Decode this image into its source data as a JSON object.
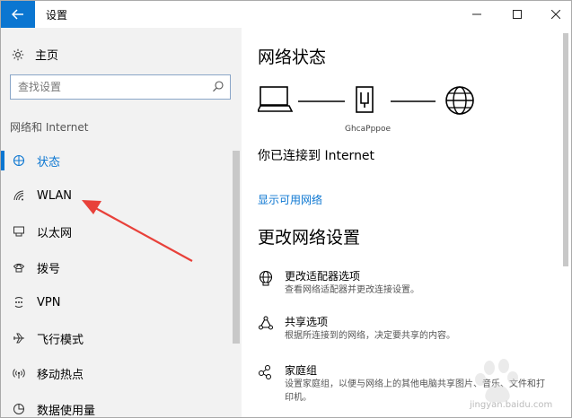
{
  "window": {
    "title": "设置"
  },
  "nav": {
    "home_label": "主页",
    "search_placeholder": "查找设置",
    "section_heading": "网络和 Internet",
    "items": [
      {
        "label": "状态",
        "icon": "globe-status-icon",
        "active": true
      },
      {
        "label": "WLAN",
        "icon": "wifi-icon",
        "active": false
      },
      {
        "label": "以太网",
        "icon": "ethernet-icon",
        "active": false
      },
      {
        "label": "拨号",
        "icon": "dialup-icon",
        "active": false
      },
      {
        "label": "VPN",
        "icon": "vpn-icon",
        "active": false
      },
      {
        "label": "飞行模式",
        "icon": "airplane-icon",
        "active": false
      },
      {
        "label": "移动热点",
        "icon": "hotspot-icon",
        "active": false
      },
      {
        "label": "数据使用量",
        "icon": "data-usage-icon",
        "active": false
      }
    ]
  },
  "main": {
    "status_heading": "网络状态",
    "device_label": "GhcaPppoe",
    "connected_text": "你已连接到 Internet",
    "show_networks_link": "显示可用网络",
    "change_heading": "更改网络设置",
    "options": [
      {
        "title": "更改适配器选项",
        "desc": "查看网络适配器并更改连接设置。",
        "icon": "adapter-globe-icon"
      },
      {
        "title": "共享选项",
        "desc": "根据所连接到的网络，决定要共享的内容。",
        "icon": "sharing-icon"
      },
      {
        "title": "家庭组",
        "desc": "设置家庭组，以便与网络上的其他电脑共享图片、音乐、文件和打印机。",
        "icon": "homegroup-icon"
      }
    ]
  },
  "watermark": {
    "text": "jingyan.baidu.com"
  },
  "colors": {
    "accent": "#0b76d1",
    "arrow": "#e8413a"
  }
}
